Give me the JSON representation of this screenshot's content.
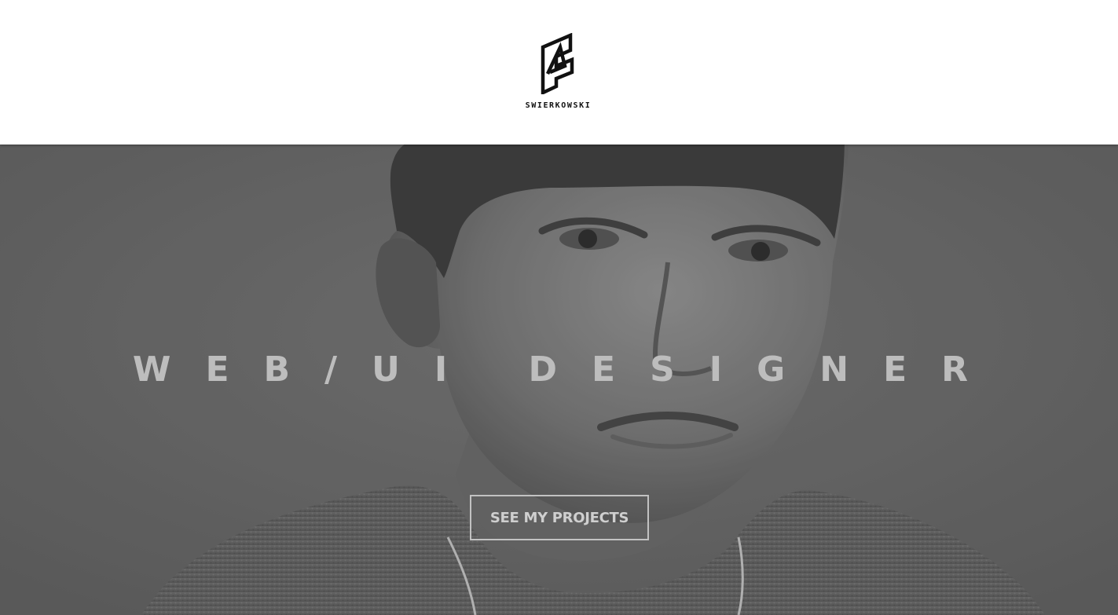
{
  "header": {
    "logo_text": "SWIERKOWSKI",
    "logo_icon": "stylized-s-a-monogram-icon"
  },
  "hero": {
    "headline": "WEB/UI DESIGNER",
    "cta_label": "SEE MY PROJECTS",
    "photo": "grayscale portrait of a man"
  },
  "colors": {
    "header_bg": "#ffffff",
    "logo": "#111111",
    "hero_tone": "#6f6f6f",
    "headline": "#bdbdbd",
    "cta_border": "#c2c2c2"
  }
}
